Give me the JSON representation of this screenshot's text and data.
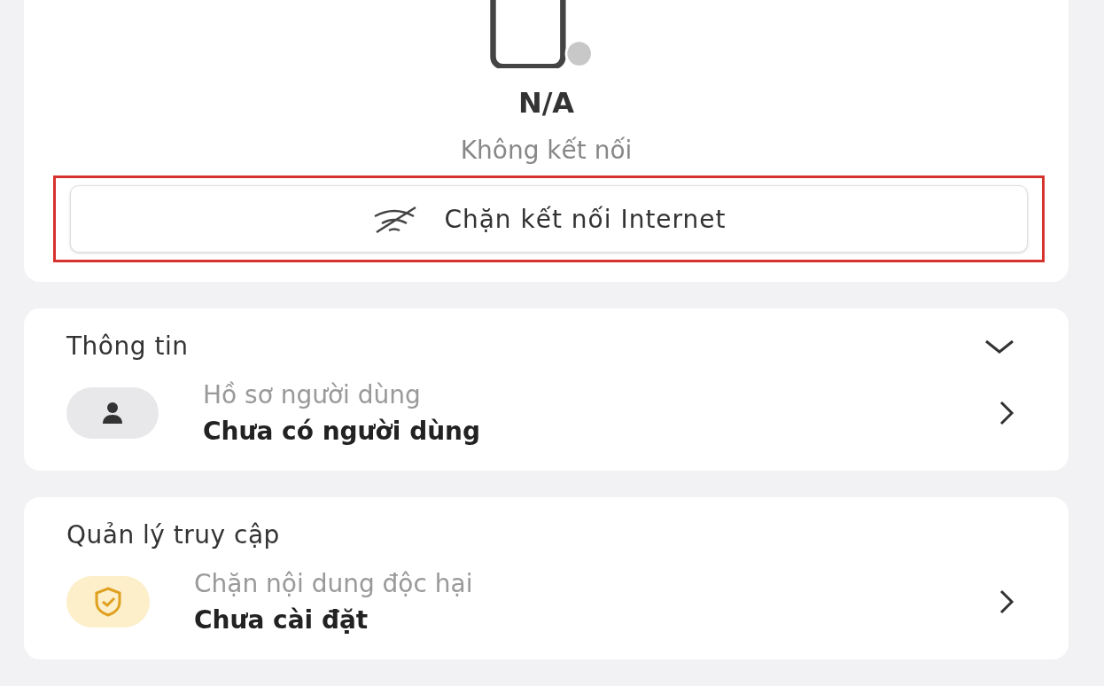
{
  "device": {
    "name": "N/A",
    "status": "Không kết nối"
  },
  "block_button": {
    "label": "Chặn kết nối Internet",
    "highlighted": true
  },
  "sections": [
    {
      "title": "Thông tin",
      "expanded": true,
      "items": [
        {
          "kind": "user",
          "label": "Hồ sơ người dùng",
          "value": "Chưa có người dùng"
        }
      ]
    },
    {
      "title": "Quản lý truy cập",
      "items": [
        {
          "kind": "shield",
          "label": "Chặn nội dung độc hại",
          "value": "Chưa cài đặt"
        }
      ]
    }
  ]
}
